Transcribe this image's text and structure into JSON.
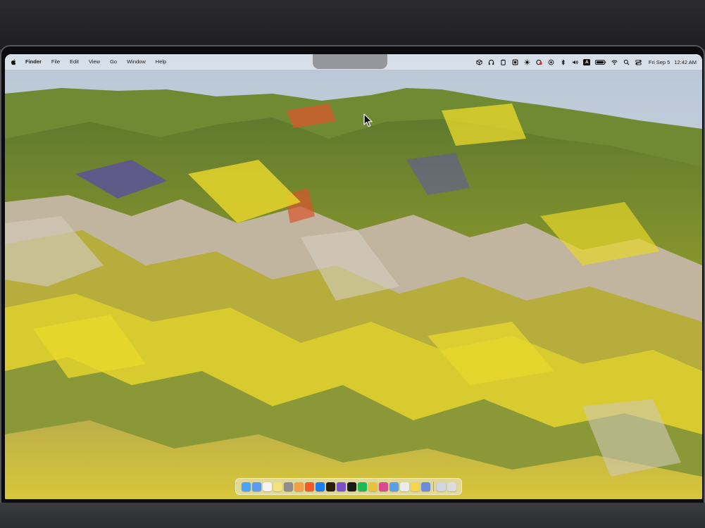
{
  "menubar": {
    "app_name": "Finder",
    "menus": [
      "File",
      "Edit",
      "View",
      "Go",
      "Window",
      "Help"
    ],
    "status_icons": [
      "box-icon",
      "headphones-icon",
      "clipboard-icon",
      "shield-icon",
      "brightness-icon",
      "red-badge-app-icon",
      "play-circle-icon",
      "bluetooth-icon",
      "volume-icon",
      "input-source-icon",
      "battery-icon",
      "wifi-icon",
      "search-icon",
      "control-center-icon"
    ],
    "input_source_label": "A",
    "date": "Fri Sep 5",
    "time": "12:42 AM"
  },
  "dock": {
    "items": [
      {
        "name": "finder",
        "color": "#4aa3ff"
      },
      {
        "name": "mail",
        "color": "#5b9cf0"
      },
      {
        "name": "calendar",
        "color": "#f4f4f4"
      },
      {
        "name": "notes",
        "color": "#f4e27a"
      },
      {
        "name": "system-settings",
        "color": "#8d8d92"
      },
      {
        "name": "photos",
        "color": "#f2a04a"
      },
      {
        "name": "swift-playgrounds",
        "color": "#f05a28"
      },
      {
        "name": "app-store",
        "color": "#1e7cf2"
      },
      {
        "name": "illustrator",
        "color": "#2a1c0a"
      },
      {
        "name": "visual-studio",
        "color": "#7b4fc9"
      },
      {
        "name": "chatgpt",
        "color": "#1a1a1a"
      },
      {
        "name": "spotify",
        "color": "#1db954"
      },
      {
        "name": "chrome",
        "color": "#e7c23a"
      },
      {
        "name": "safari",
        "color": "#d94b8b"
      },
      {
        "name": "transmit",
        "color": "#5aa0e6"
      },
      {
        "name": "craft",
        "color": "#eaeaea"
      },
      {
        "name": "messages",
        "color": "#f5d54a"
      },
      {
        "name": "preview",
        "color": "#6d8cd8"
      },
      {
        "name": "downloads-folder",
        "color": "#cfd6de"
      },
      {
        "name": "trash",
        "color": "#dcdcdc"
      }
    ],
    "separator_after_index": 17
  }
}
